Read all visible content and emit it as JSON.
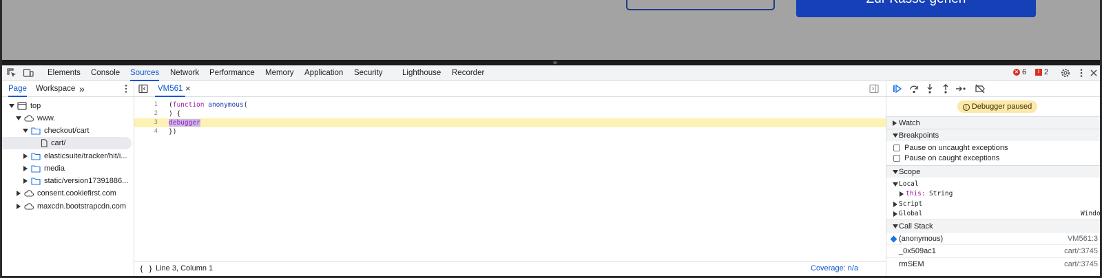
{
  "page": {
    "primary_button_label": "Zur Kasse gehen"
  },
  "devtools": {
    "tabs": [
      "Elements",
      "Console",
      "Sources",
      "Network",
      "Performance",
      "Memory",
      "Application",
      "Security",
      "Lighthouse",
      "Recorder"
    ],
    "active_tab": "Sources",
    "errors_count": "6",
    "issues_count": "2",
    "icons": {
      "inspect": "inspect-element-icon",
      "device": "device-toolbar-icon",
      "settings": "gear-icon",
      "more": "kebab-menu-icon",
      "close": "close-icon"
    }
  },
  "navigator": {
    "tabs": [
      "Page",
      "Workspace"
    ],
    "more_label": "»",
    "tree": [
      {
        "label": "top",
        "icon": "frame-icon",
        "level": 0,
        "expanded": true
      },
      {
        "label": "www.",
        "icon": "cloud-icon",
        "level": 1,
        "expanded": true
      },
      {
        "label": "checkout/cart",
        "icon": "folder-icon",
        "level": 2,
        "expanded": true
      },
      {
        "label": "cart/",
        "icon": "file-icon",
        "level": 3,
        "selected": true
      },
      {
        "label": "elasticsuite/tracker/hit/i...",
        "icon": "folder-icon",
        "level": 2,
        "expanded": false
      },
      {
        "label": "media",
        "icon": "folder-icon",
        "level": 2,
        "expanded": false
      },
      {
        "label": "static/version17391886...",
        "icon": "folder-icon",
        "level": 2,
        "expanded": false
      },
      {
        "label": "consent.cookiefirst.com",
        "icon": "cloud-icon",
        "level": 1,
        "expanded": false
      },
      {
        "label": "maxcdn.bootstrapcdn.com",
        "icon": "cloud-icon",
        "level": 1,
        "expanded": false
      }
    ]
  },
  "editor": {
    "file_tab": "VM561",
    "lines": [
      {
        "num": "1",
        "text": "(function anonymous("
      },
      {
        "num": "2",
        "text": ") {"
      },
      {
        "num": "3",
        "text": "debugger"
      },
      {
        "num": "4",
        "text": "})"
      }
    ],
    "paused_line": 3,
    "status_position": "Line 3, Column 1",
    "status_coverage": "Coverage: n/a"
  },
  "debugger": {
    "paused_label": "Debugger paused",
    "sections": {
      "watch": "Watch",
      "breakpoints": "Breakpoints",
      "scope": "Scope",
      "call_stack": "Call Stack"
    },
    "breakpoint_options": [
      "Pause on uncaught exceptions",
      "Pause on caught exceptions"
    ],
    "scope": {
      "local": "Local",
      "this_key": "this:",
      "this_value": "String",
      "script": "Script",
      "global": "Global",
      "global_value": "Windo"
    },
    "call_stack": [
      {
        "name": "(anonymous)",
        "location": "VM561:3",
        "current": true
      },
      {
        "name": "_0x509ac1",
        "location": "cart/:3745"
      },
      {
        "name": "rmSEM",
        "location": "cart/:3745"
      }
    ]
  }
}
